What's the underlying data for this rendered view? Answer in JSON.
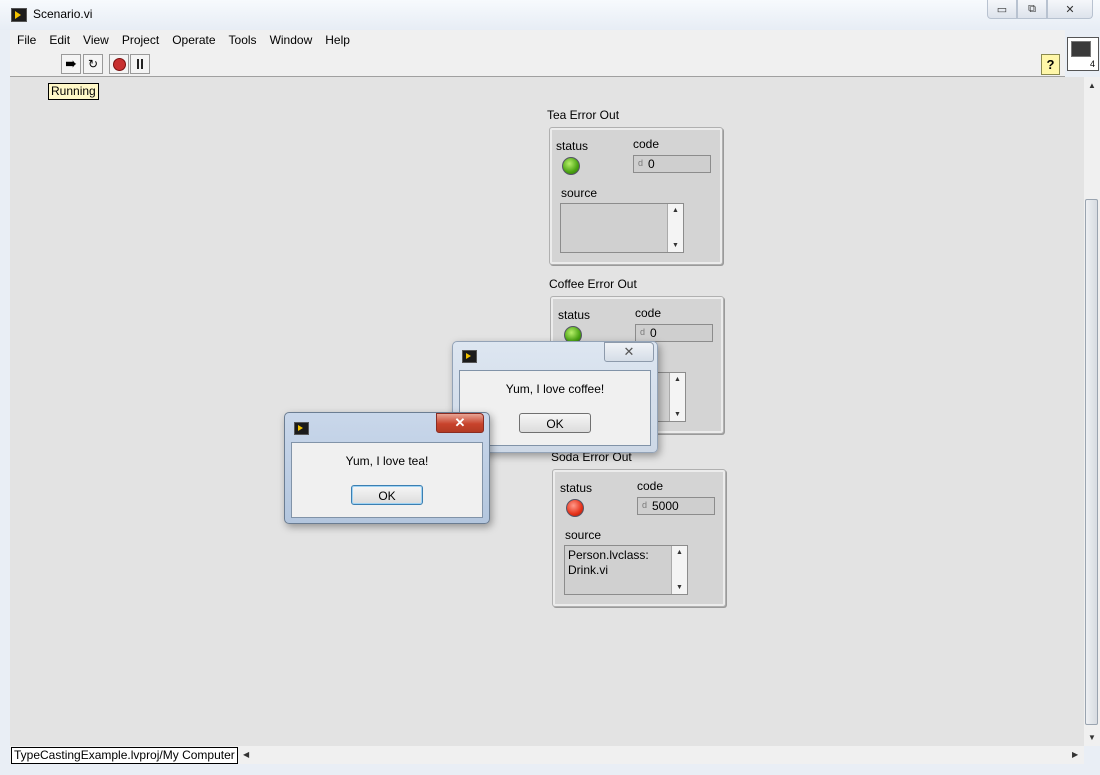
{
  "window": {
    "title": "Scenario.vi",
    "buttons": {
      "minimize": "▭",
      "restore": "⧉",
      "close": "✕"
    }
  },
  "menu": [
    "File",
    "Edit",
    "View",
    "Project",
    "Operate",
    "Tools",
    "Window",
    "Help"
  ],
  "toolbar": {
    "run_icon": "run-continuously-arrow-icon",
    "run_continuously_icon": "run-continuously-icon",
    "abort_icon": "abort-execution-icon",
    "pause_icon": "pause-icon",
    "help_label": "?",
    "connector_pane_number": "4"
  },
  "panel": {
    "running_label": "Running"
  },
  "clusters": {
    "tea": {
      "label": "Tea Error Out",
      "status_label": "status",
      "code_label": "code",
      "code_radix": "d",
      "code": "0",
      "source_label": "source",
      "source": "",
      "status_color": "#4aa312"
    },
    "coffee": {
      "label": "Coffee Error Out",
      "status_label": "status",
      "code_label": "code",
      "code_radix": "d",
      "code": "0",
      "source_label": "source",
      "source": "",
      "status_color": "#4aa312"
    },
    "soda": {
      "label": "Soda Error Out",
      "status_label": "status",
      "code_label": "code",
      "code_radix": "d",
      "code": "5000",
      "source_label": "source",
      "source": "Person.lvclass: Drink.vi",
      "status_color": "#e5321a"
    }
  },
  "dialogs": {
    "coffee": {
      "message": "Yum, I love coffee!",
      "ok_label": "OK"
    },
    "tea": {
      "message": "Yum, I love tea!",
      "ok_label": "OK"
    }
  },
  "statusbar": {
    "path": "TypeCastingExample.lvproj/My Computer"
  }
}
